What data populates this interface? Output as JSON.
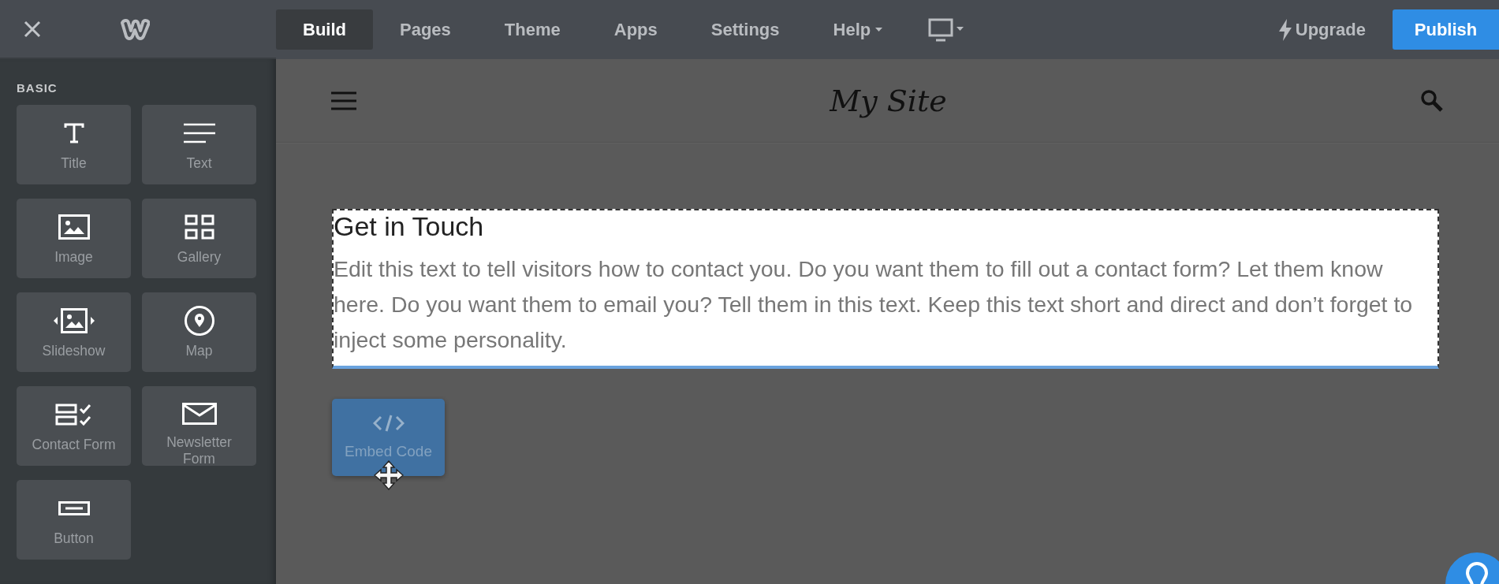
{
  "topbar": {
    "tabs": [
      {
        "label": "Build",
        "selected": true,
        "kind": "tab"
      },
      {
        "label": "Pages",
        "selected": false,
        "kind": "tab"
      },
      {
        "label": "Theme",
        "selected": false,
        "kind": "tab"
      },
      {
        "label": "Apps",
        "selected": false,
        "kind": "tab"
      },
      {
        "label": "Settings",
        "selected": false,
        "kind": "tab"
      },
      {
        "label": "Help",
        "selected": false,
        "kind": "menu"
      }
    ],
    "upgrade": "Upgrade",
    "publish": "Publish"
  },
  "sidebar": {
    "section": "BASIC",
    "elements": [
      {
        "label": "Title",
        "kind": "title"
      },
      {
        "label": "Text",
        "kind": "text"
      },
      {
        "label": "Image",
        "kind": "image"
      },
      {
        "label": "Gallery",
        "kind": "gallery"
      },
      {
        "label": "Slideshow",
        "kind": "slideshow"
      },
      {
        "label": "Map",
        "kind": "map"
      },
      {
        "label": "Contact Form",
        "kind": "form"
      },
      {
        "label": "Newsletter Form",
        "kind": "newsletter"
      },
      {
        "label": "Button",
        "kind": "button"
      }
    ]
  },
  "site": {
    "title": "My Site",
    "heading": "Get in Touch",
    "paragraph": "Edit this text to tell visitors how to contact you. Do you want them to fill out a contact form? Let them know here. Do you want them to email you? Tell them in this text. Keep this text short and direct and don’t forget to inject some personality.",
    "dragged_element": {
      "label": "Embed Code",
      "kind": "embed"
    }
  }
}
